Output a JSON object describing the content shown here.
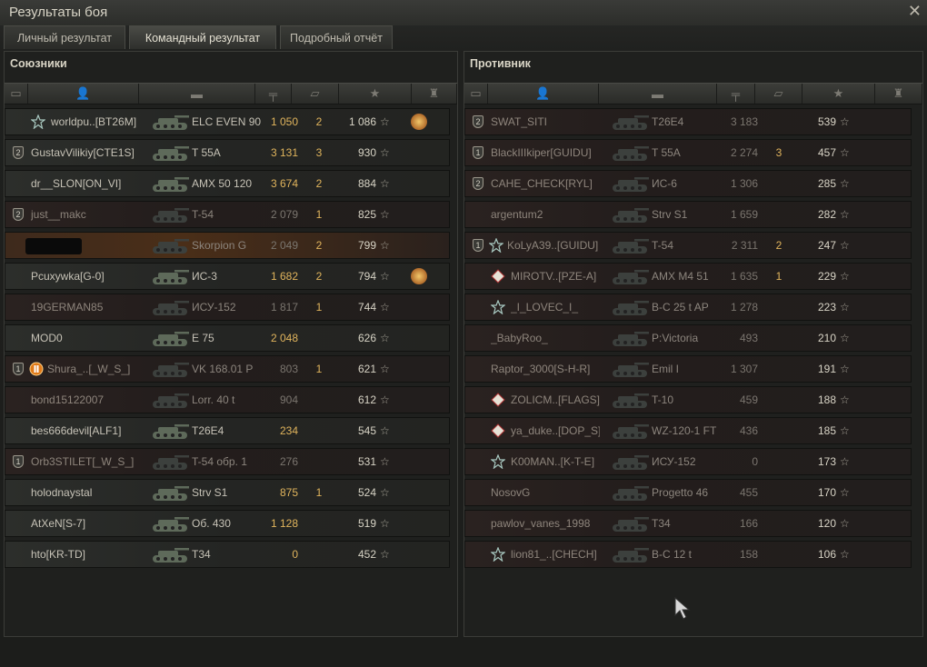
{
  "window": {
    "title": "Результаты боя"
  },
  "tabs": [
    "Личный результат",
    "Командный результат",
    "Подробный отчёт"
  ],
  "allies": {
    "title": "Союзники",
    "rows": [
      {
        "name": "worldpu..[BT26M]",
        "tank": "ELC EVEN 90",
        "damage": "1 050",
        "frags": "2",
        "xp": "1 086",
        "alive": true,
        "squad": "",
        "badge": "star",
        "ach": true
      },
      {
        "name": "GustavVilikiy[CTE1S]",
        "tank": "T 55A",
        "damage": "3 131",
        "frags": "3",
        "xp": "930",
        "alive": true,
        "squad": "2",
        "badge": "",
        "ach": false
      },
      {
        "name": "dr__SLON[ON_VI]",
        "tank": "AMX 50 120",
        "damage": "3 674",
        "frags": "2",
        "xp": "884",
        "alive": true,
        "squad": "",
        "badge": "",
        "ach": false
      },
      {
        "name": "just__makc",
        "tank": "T-54",
        "damage": "2 079",
        "frags": "1",
        "xp": "825",
        "alive": false,
        "squad": "2",
        "badge": "",
        "ach": false
      },
      {
        "name": "",
        "tank": "Skorpion G",
        "damage": "2 049",
        "frags": "2",
        "xp": "799",
        "alive": false,
        "squad": "",
        "badge": "",
        "ach": false,
        "mine": true
      },
      {
        "name": "Pcuxywka[G-0]",
        "tank": "ИС-3",
        "damage": "1 682",
        "frags": "2",
        "xp": "794",
        "alive": true,
        "squad": "",
        "badge": "",
        "ach": true
      },
      {
        "name": "19GERMAN85",
        "tank": "ИСУ-152",
        "damage": "1 817",
        "frags": "1",
        "xp": "744",
        "alive": false,
        "squad": "",
        "badge": "",
        "ach": false
      },
      {
        "name": "MOD0",
        "tank": "E 75",
        "damage": "2 048",
        "frags": "",
        "xp": "626",
        "alive": true,
        "squad": "",
        "badge": "",
        "ach": false
      },
      {
        "name": "Shura_..[_W_S_]",
        "tank": "VK 168.01 P",
        "damage": "803",
        "frags": "1",
        "xp": "621",
        "alive": false,
        "squad": "1",
        "badge": "orange",
        "ach": false
      },
      {
        "name": "bond15122007",
        "tank": "Lorr. 40 t",
        "damage": "904",
        "frags": "",
        "xp": "612",
        "alive": false,
        "squad": "",
        "badge": "",
        "ach": false
      },
      {
        "name": "bes666devil[ALF1]",
        "tank": "T26E4",
        "damage": "234",
        "frags": "",
        "xp": "545",
        "alive": true,
        "squad": "",
        "badge": "",
        "ach": false
      },
      {
        "name": "Orb3STILET[_W_S_]",
        "tank": "T-54 обр. 1",
        "damage": "276",
        "frags": "",
        "xp": "531",
        "alive": false,
        "squad": "1",
        "badge": "",
        "ach": false
      },
      {
        "name": "holodnaystal",
        "tank": "Strv S1",
        "damage": "875",
        "frags": "1",
        "xp": "524",
        "alive": true,
        "squad": "",
        "badge": "",
        "ach": false
      },
      {
        "name": "AtXeN[S-7]",
        "tank": "Об. 430",
        "damage": "1 128",
        "frags": "",
        "xp": "519",
        "alive": true,
        "squad": "",
        "badge": "",
        "ach": false
      },
      {
        "name": "hto[KR-TD]",
        "tank": "T34",
        "damage": "0",
        "frags": "",
        "xp": "452",
        "alive": true,
        "squad": "",
        "badge": "",
        "ach": false
      }
    ]
  },
  "enemies": {
    "title": "Противник",
    "rows": [
      {
        "name": "SWAT_SITI",
        "tank": "T26E4",
        "damage": "3 183",
        "frags": "",
        "xp": "539",
        "alive": false,
        "squad": "2",
        "badge": "",
        "ach": false
      },
      {
        "name": "BlackIIIkiper[GUIDU]",
        "tank": "T 55A",
        "damage": "2 274",
        "frags": "3",
        "xp": "457",
        "alive": false,
        "squad": "1",
        "badge": "",
        "ach": false
      },
      {
        "name": "CAHE_CHECK[RYL]",
        "tank": "ИС-6",
        "damage": "1 306",
        "frags": "",
        "xp": "285",
        "alive": false,
        "squad": "2",
        "badge": "",
        "ach": false
      },
      {
        "name": "argentum2",
        "tank": "Strv S1",
        "damage": "1 659",
        "frags": "",
        "xp": "282",
        "alive": false,
        "squad": "",
        "badge": "",
        "ach": false
      },
      {
        "name": "KoLyA39..[GUIDU]",
        "tank": "T-54",
        "damage": "2 311",
        "frags": "2",
        "xp": "247",
        "alive": false,
        "squad": "1",
        "badge": "star",
        "ach": false
      },
      {
        "name": "MIROTV..[PZE-A]",
        "tank": "AMX M4 51",
        "damage": "1 635",
        "frags": "1",
        "xp": "229",
        "alive": false,
        "squad": "",
        "badge": "diamond",
        "ach": false
      },
      {
        "name": "_I_LOVEC_I_",
        "tank": "B-C 25 t AP",
        "damage": "1 278",
        "frags": "",
        "xp": "223",
        "alive": false,
        "squad": "",
        "badge": "star",
        "ach": false
      },
      {
        "name": "_BabyRoo_",
        "tank": "P:Victoria",
        "damage": "493",
        "frags": "",
        "xp": "210",
        "alive": false,
        "squad": "",
        "badge": "",
        "ach": false
      },
      {
        "name": "Raptor_3000[S-H-R]",
        "tank": "Emil I",
        "damage": "1 307",
        "frags": "",
        "xp": "191",
        "alive": false,
        "squad": "",
        "badge": "",
        "ach": false
      },
      {
        "name": "ZOLICM..[FLAGS]",
        "tank": "T-10",
        "damage": "459",
        "frags": "",
        "xp": "188",
        "alive": false,
        "squad": "",
        "badge": "diamond",
        "ach": false
      },
      {
        "name": "ya_duke..[DOP_S]",
        "tank": "WZ-120-1 FT",
        "damage": "436",
        "frags": "",
        "xp": "185",
        "alive": false,
        "squad": "",
        "badge": "diamond",
        "ach": false
      },
      {
        "name": "K00MAN..[K-T-E]",
        "tank": "ИСУ-152",
        "damage": "0",
        "frags": "",
        "xp": "173",
        "alive": false,
        "squad": "",
        "badge": "star",
        "ach": false
      },
      {
        "name": "NosovG",
        "tank": "Progetto 46",
        "damage": "455",
        "frags": "",
        "xp": "170",
        "alive": false,
        "squad": "",
        "badge": "",
        "ach": false
      },
      {
        "name": "pawlov_vanes_1998",
        "tank": "T34",
        "damage": "166",
        "frags": "",
        "xp": "120",
        "alive": false,
        "squad": "",
        "badge": "",
        "ach": false
      },
      {
        "name": "lion81_..[CHECH]",
        "tank": "B-C 12 t",
        "damage": "158",
        "frags": "",
        "xp": "106",
        "alive": false,
        "squad": "",
        "badge": "star",
        "ach": false
      }
    ]
  },
  "icons": {
    "close": "close-icon",
    "columns": [
      "squad-column-icon",
      "player-column-icon",
      "vehicle-column-icon",
      "damage-column-icon",
      "frags-column-icon",
      "xp-column-icon",
      "achievement-column-icon"
    ]
  },
  "colors": {
    "damage": "#e0b45c",
    "frags": "#e0b45c"
  }
}
